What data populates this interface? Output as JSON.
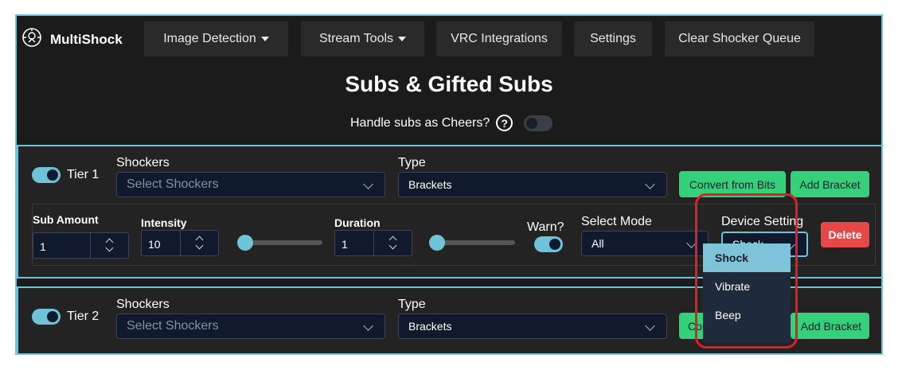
{
  "navbar": {
    "brand": "MultiShock",
    "items": [
      {
        "label": "Image Detection",
        "has_caret": true
      },
      {
        "label": "Stream Tools",
        "has_caret": true
      },
      {
        "label": "VRC Integrations",
        "has_caret": false
      },
      {
        "label": "Settings",
        "has_caret": false
      },
      {
        "label": "Clear Shocker Queue",
        "has_caret": false
      }
    ]
  },
  "page": {
    "title": "Subs & Gifted Subs",
    "cheers_label": "Handle subs as Cheers?",
    "help_glyph": "?",
    "cheers_enabled": false
  },
  "tier1": {
    "label": "Tier 1",
    "enabled": true,
    "shockers_label": "Shockers",
    "shockers_placeholder": "Select Shockers",
    "type_label": "Type",
    "type_value": "Brackets",
    "convert_label": "Convert from Bits",
    "add_bracket_label": "Add Bracket",
    "bracket": {
      "sub_amount_label": "Sub Amount",
      "sub_amount": "1",
      "intensity_label": "Intensity",
      "intensity": "10",
      "duration_label": "Duration",
      "duration": "1",
      "warn_label": "Warn?",
      "warn_enabled": true,
      "select_mode_label": "Select Mode",
      "select_mode": "All",
      "device_setting_label": "Device Setting",
      "device_setting": "Shock",
      "delete_label": "Delete"
    }
  },
  "tier2": {
    "label": "Tier 2",
    "enabled": true,
    "shockers_label": "Shockers",
    "shockers_placeholder": "Select Shockers",
    "type_label": "Type",
    "type_value": "Brackets",
    "convert_label_visible": "Conve",
    "add_bracket_label_visible": "Add Bracket"
  },
  "device_dropdown": {
    "options": [
      "Shock",
      "Vibrate",
      "Beep"
    ],
    "selected": "Shock"
  },
  "colors": {
    "accent": "#6fc3d8",
    "green": "#35d17a",
    "danger": "#e84747",
    "highlight": "#e31c25"
  }
}
